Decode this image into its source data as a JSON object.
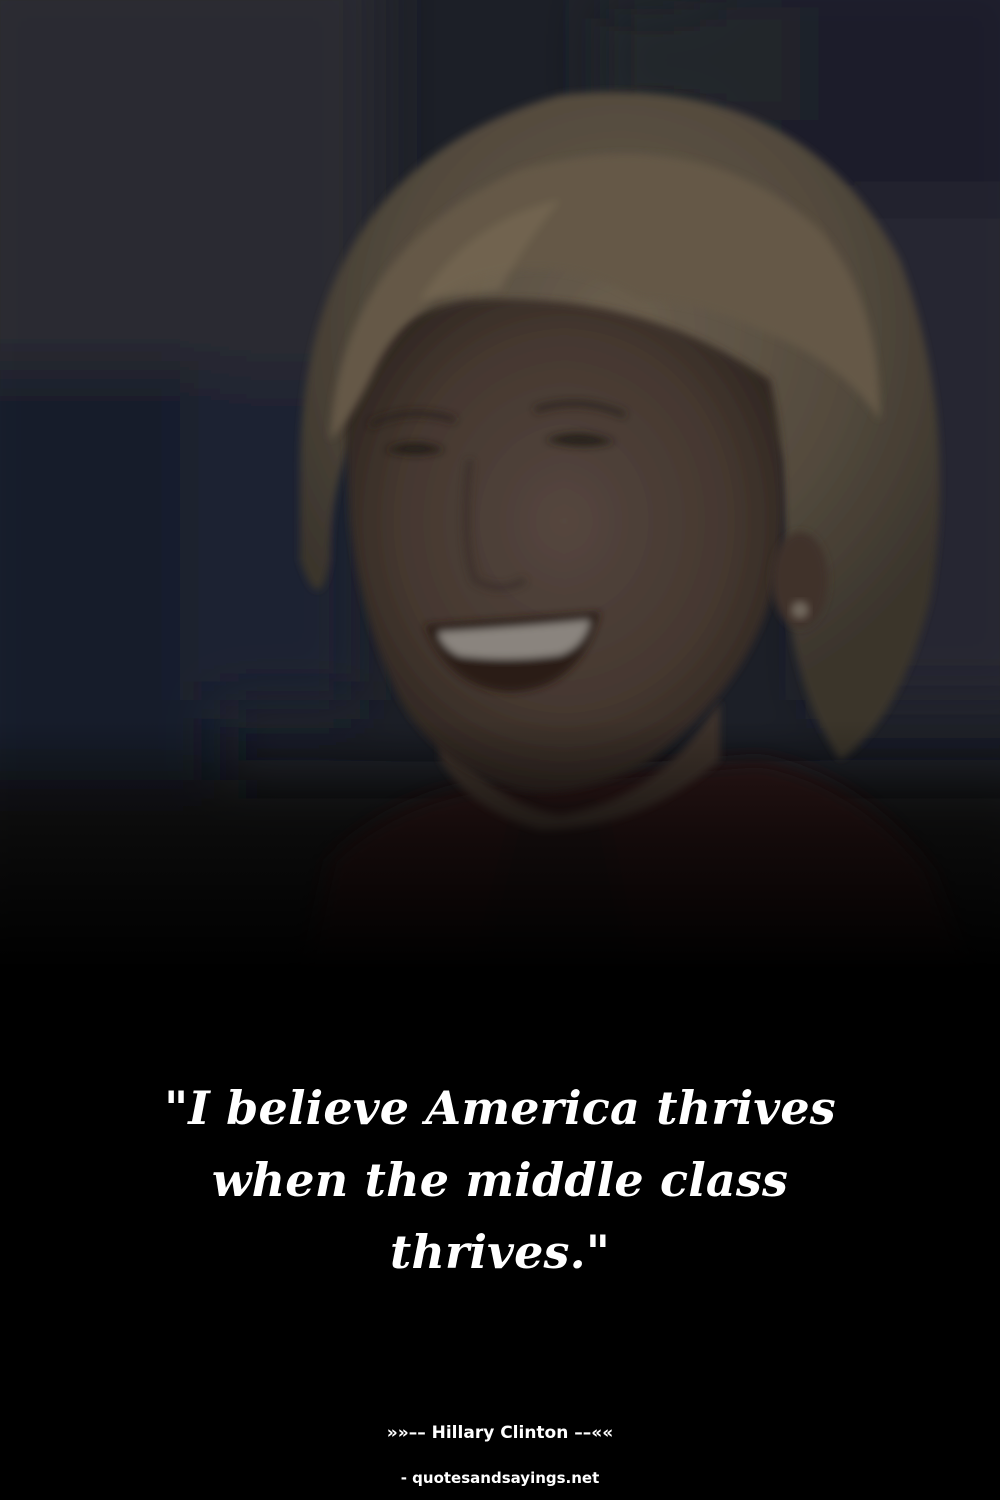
{
  "quote": {
    "text": "\"I believe America thrives when the middle class thrives.\""
  },
  "attribution": {
    "author_line": "»»–– Hillary Clinton ––««",
    "source_line": "- quotesandsayings.net"
  },
  "photo": {
    "subject": "smiling woman with short blonde hair in red jacket, dimmed background photo"
  },
  "colors": {
    "background": "#000000",
    "text": "#ffffff"
  }
}
